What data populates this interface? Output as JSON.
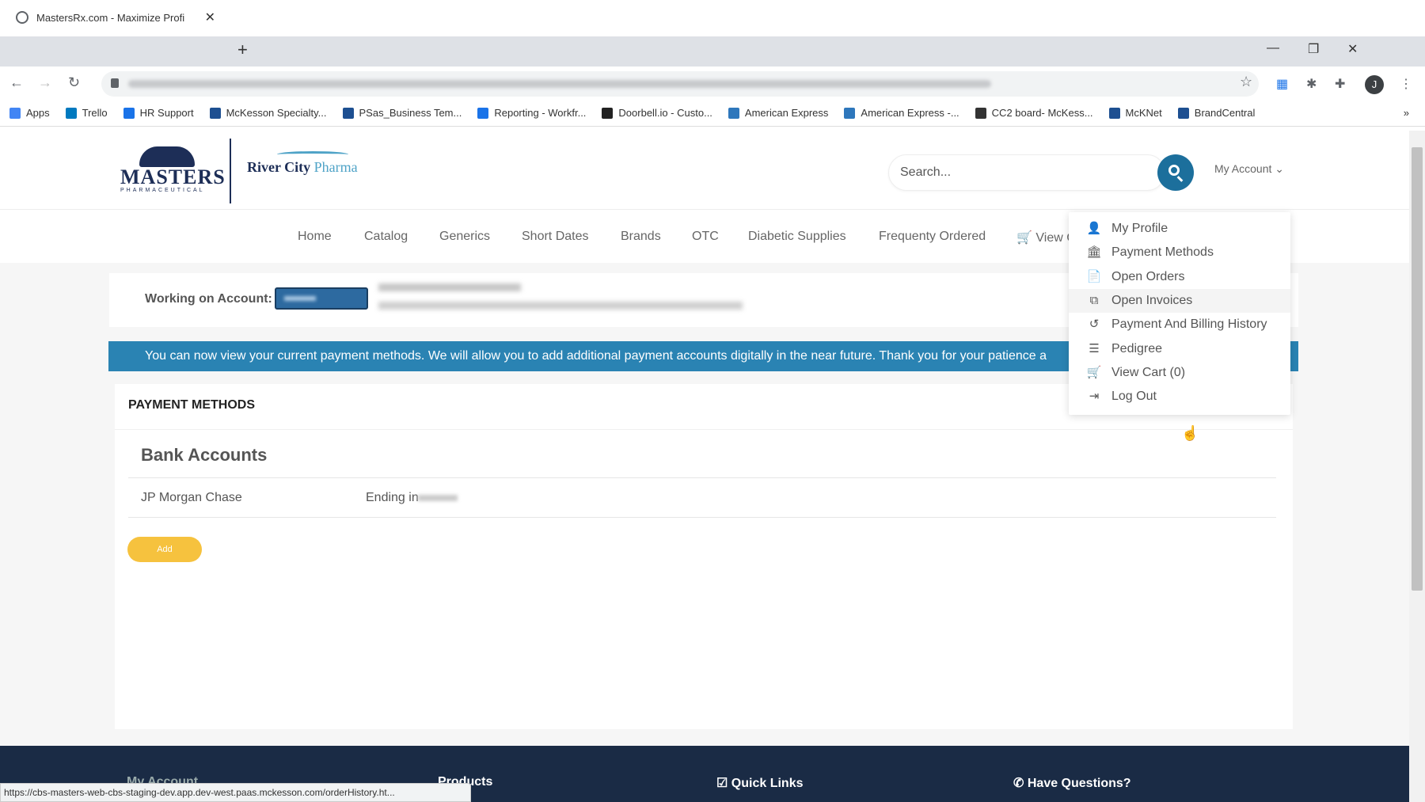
{
  "browser": {
    "tab_title": "MastersRx.com - Maximize Profi",
    "tab_close": "✕",
    "new_tab": "+",
    "window_controls": [
      "—",
      "❐",
      "✕"
    ],
    "profile_initial": "J",
    "bookmarks": [
      {
        "label": "Apps",
        "color": "#4285f4"
      },
      {
        "label": "Trello",
        "color": "#0079bf"
      },
      {
        "label": "HR Support",
        "color": "#1a73e8"
      },
      {
        "label": "McKesson Specialty...",
        "color": "#1d4f91"
      },
      {
        "label": "PSas_Business Tem...",
        "color": "#1d4f91"
      },
      {
        "label": "Reporting - Workfr...",
        "color": "#1a73e8"
      },
      {
        "label": "Doorbell.io - Custo...",
        "color": "#222222"
      },
      {
        "label": "American Express",
        "color": "#2e77bc"
      },
      {
        "label": "American Express -...",
        "color": "#2e77bc"
      },
      {
        "label": "CC2 board- McKess...",
        "color": "#333333"
      },
      {
        "label": "McKNet",
        "color": "#1d4f91"
      },
      {
        "label": "BrandCentral",
        "color": "#1d4f91"
      }
    ],
    "bookmarks_more": "»",
    "status_url": "https://cbs-masters-web-cbs-staging-dev.app.dev-west.paas.mckesson.com/orderHistory.ht..."
  },
  "header": {
    "logo_masters": "MASTERS",
    "logo_masters_sub": "PHARMACEUTICAL",
    "logo_rc_bold": "River City",
    "logo_rc_light": "Pharma",
    "search_placeholder": "Search...",
    "my_account": "My Account ⌄"
  },
  "nav": {
    "items": [
      "Home",
      "Catalog",
      "Generics",
      "Short Dates",
      "Brands",
      "OTC",
      "Diabetic Supplies",
      "Frequenty Ordered",
      "View C"
    ]
  },
  "account": {
    "label": "Working on Account:"
  },
  "banner": {
    "text": "You can now view your current payment methods. We will allow you to add additional payment accounts digitally in the near future. Thank you for your patience a"
  },
  "payment": {
    "title": "PAYMENT METHODS",
    "bank_accounts_title": "Bank Accounts",
    "bank_name": "JP Morgan Chase",
    "ending_label": "Ending in",
    "add_label": "Add"
  },
  "dropdown": {
    "items": [
      {
        "label": "My Profile",
        "icon": "user-icon",
        "glyph": "👤"
      },
      {
        "label": "Payment Methods",
        "icon": "bank-icon",
        "glyph": "🏛"
      },
      {
        "label": "Open Orders",
        "icon": "document-icon",
        "glyph": "📄"
      },
      {
        "label": "Open Invoices",
        "icon": "copy-icon",
        "glyph": "⧉"
      },
      {
        "label": "Payment And Billing History",
        "icon": "history-icon",
        "glyph": "↺"
      },
      {
        "label": "Pedigree",
        "icon": "list-icon",
        "glyph": "☰"
      },
      {
        "label": "View Cart (0)",
        "icon": "cart-icon",
        "glyph": "🛒"
      },
      {
        "label": "Log Out",
        "icon": "logout-icon",
        "glyph": "⇥"
      }
    ]
  },
  "footer": {
    "items": [
      "My Account",
      "Products",
      "Quick Links",
      "Have Questions?"
    ]
  },
  "colors": {
    "primary": "#1c6f9c",
    "banner": "#2a83b3",
    "add_button": "#f6c23e",
    "footer": "#1a2b45"
  }
}
